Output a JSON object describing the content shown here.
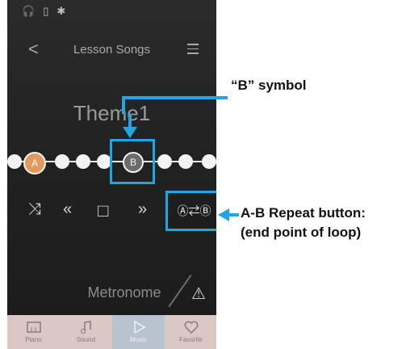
{
  "colors": {
    "accent_callout": "#1ea7e2",
    "marker_a": "#e29a5d",
    "tabbar_bg": "#d9c8c3",
    "tab_active_bg": "#b9c2cf"
  },
  "status_icons": [
    "headphones-icon",
    "phone-icon",
    "bluetooth-icon"
  ],
  "nav": {
    "back_symbol": "<",
    "title": "Lesson Songs"
  },
  "song": {
    "title": "Theme1"
  },
  "markers": {
    "a_label": "A",
    "b_label": "B"
  },
  "controls": [
    "shuffle-icon",
    "rewind-icon",
    "stop-icon",
    "forward-icon",
    "ab-repeat-icon"
  ],
  "metronome": {
    "label": "Metronome",
    "icon_symbol": "⚠"
  },
  "tabs": [
    {
      "label": "Piano",
      "icon": "piano-icon"
    },
    {
      "label": "Sound",
      "icon": "music-note-icon"
    },
    {
      "label": "Music",
      "icon": "play-icon",
      "active": true
    },
    {
      "label": "Favorite",
      "icon": "heart-icon"
    }
  ],
  "annotations": {
    "b_symbol": "“B” symbol",
    "ab_line1": "A-B Repeat button:",
    "ab_line2": "(end point of loop)"
  }
}
